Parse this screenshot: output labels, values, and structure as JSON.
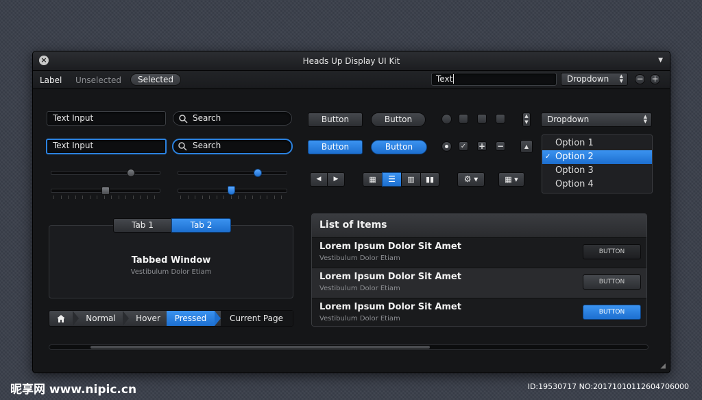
{
  "window": {
    "title": "Heads Up Display UI Kit",
    "close_icon": "close-icon",
    "menu_icon": "triangle-down-icon"
  },
  "toolbar": {
    "label": "Label",
    "unselected": "Unselected",
    "selected": "Selected",
    "text_field_value": "Text",
    "dropdown_value": "Dropdown"
  },
  "inputs": {
    "text_input_1": "Text Input",
    "search_1": "Search",
    "text_input_2": "Text Input",
    "search_2": "Search"
  },
  "buttons": {
    "button_1": "Button",
    "button_round_1": "Button",
    "button_2": "Button",
    "button_round_2": "Button"
  },
  "dropdown": {
    "value": "Dropdown",
    "options": [
      "Option 1",
      "Option 2",
      "Option 3",
      "Option 4"
    ],
    "selected_index": 1
  },
  "sliders": {
    "s1": 0.75,
    "s2": 0.75,
    "s3": 0.5,
    "s4": 0.5
  },
  "tabs": {
    "tab1": "Tab 1",
    "tab2": "Tab 2",
    "active": "Tab 2"
  },
  "tabbed_window": {
    "title": "Tabbed Window",
    "subtitle": "Vestibulum Dolor Etiam"
  },
  "breadcrumb": {
    "items": [
      "Normal",
      "Hover",
      "Pressed",
      "Current Page"
    ]
  },
  "list": {
    "header": "List of Items",
    "rows": [
      {
        "title": "Lorem Ipsum Dolor Sit Amet",
        "subtitle": "Vestibulum Dolor Etiam",
        "button": "BUTTON"
      },
      {
        "title": "Lorem Ipsum Dolor Sit Amet",
        "subtitle": "Vestibulum Dolor Etiam",
        "button": "BUTTON"
      },
      {
        "title": "Lorem Ipsum Dolor Sit Amet",
        "subtitle": "Vestibulum Dolor Etiam",
        "button": "BUTTON"
      }
    ]
  },
  "watermark": {
    "left": "昵享网 www.nipic.cn",
    "right": "ID:19530717 NO:20171010112604706000"
  },
  "colors": {
    "accent": "#2b82e0",
    "window_bg": "#151618",
    "page_bg": "#3a3f4a"
  }
}
